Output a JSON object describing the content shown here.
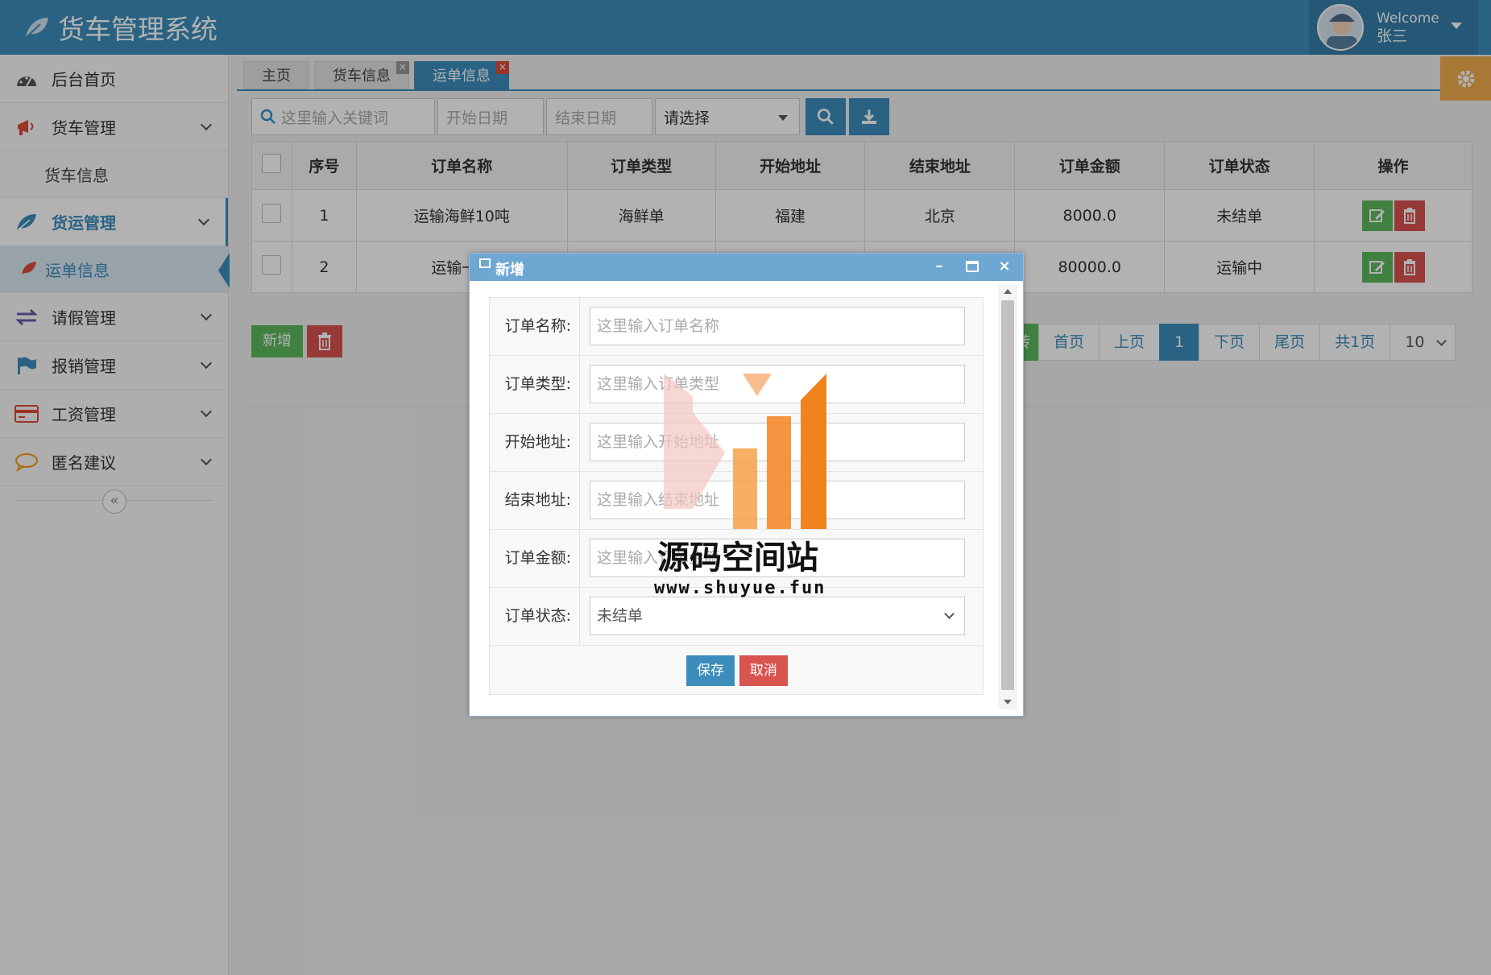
{
  "app": {
    "title": "货车管理系统"
  },
  "user": {
    "welcome": "Welcome",
    "name": "张三"
  },
  "sidebar": {
    "items": [
      {
        "label": "后台首页",
        "icon": "dashboard-icon"
      },
      {
        "label": "货车管理",
        "icon": "bullhorn-icon"
      },
      {
        "label": "货车信息"
      },
      {
        "label": "货运管理",
        "icon": "leaf-icon"
      },
      {
        "label": "运单信息",
        "icon": "leaf-icon"
      },
      {
        "label": "请假管理",
        "icon": "exchange-icon"
      },
      {
        "label": "报销管理",
        "icon": "flag-icon"
      },
      {
        "label": "工资管理",
        "icon": "credit-card-icon"
      },
      {
        "label": "匿名建议",
        "icon": "comment-icon"
      }
    ],
    "collapse_label": "«"
  },
  "tabs": [
    {
      "label": "主页"
    },
    {
      "label": "货车信息"
    },
    {
      "label": "运单信息"
    }
  ],
  "toolbar": {
    "keyword_placeholder": "这里输入关键词",
    "start_date_placeholder": "开始日期",
    "end_date_placeholder": "结束日期",
    "select_value": "请选择"
  },
  "table": {
    "headers": [
      "序号",
      "订单名称",
      "订单类型",
      "开始地址",
      "结束地址",
      "订单金额",
      "订单状态",
      "操作"
    ],
    "rows": [
      {
        "index": "1",
        "name": "运输海鲜10吨",
        "type": "海鲜单",
        "start": "福建",
        "end": "北京",
        "amount": "8000.0",
        "status": "未结单"
      },
      {
        "index": "2",
        "name": "运输一批",
        "type": "",
        "start": "",
        "end": "",
        "amount": "80000.0",
        "status": "运输中"
      }
    ]
  },
  "actions": {
    "add_label": "新增"
  },
  "pager": {
    "goto": "转",
    "first": "首页",
    "prev": "上页",
    "current": "1",
    "next": "下页",
    "last": "尾页",
    "total": "共1页",
    "page_size": "10"
  },
  "modal": {
    "title": "新增",
    "fields": [
      {
        "label": "订单名称:",
        "placeholder": "这里输入订单名称"
      },
      {
        "label": "订单类型:",
        "placeholder": "这里输入订单类型"
      },
      {
        "label": "开始地址:",
        "placeholder": "这里输入开始地址"
      },
      {
        "label": "结束地址:",
        "placeholder": "这里输入结束地址"
      },
      {
        "label": "订单金额:",
        "placeholder": "这里输入订单金额"
      },
      {
        "label": "订单状态:",
        "value": "未结单"
      }
    ],
    "save_label": "保存",
    "cancel_label": "取消"
  },
  "watermark": {
    "name": "源码空间站",
    "url": "www.shuyue.fun"
  },
  "colors": {
    "primary": "#3c8dbc",
    "success": "#5cb85c",
    "danger": "#d9534f",
    "warning": "#f0ad4e"
  }
}
